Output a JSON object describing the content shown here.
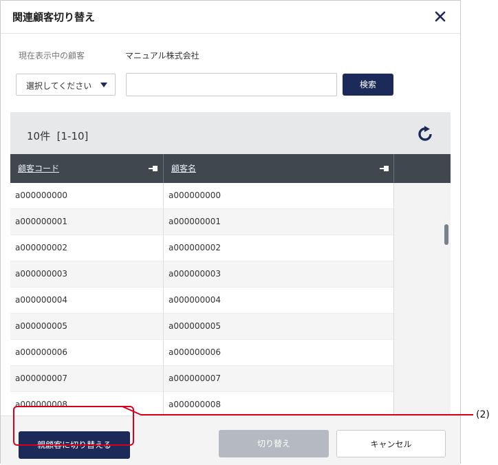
{
  "dialog": {
    "title": "関連顧客切り替え"
  },
  "current_customer": {
    "label": "現在表示中の顧客",
    "value": "マニュアル株式会社"
  },
  "search": {
    "select_value": "選択してください",
    "input_value": "",
    "button_label": "検索"
  },
  "results": {
    "count_text": "10件",
    "range_text": "[1-10]"
  },
  "table": {
    "columns": [
      {
        "label": "顧客コード"
      },
      {
        "label": "顧客名"
      }
    ],
    "rows": [
      {
        "code": "a000000000",
        "name": "a000000000"
      },
      {
        "code": "a000000001",
        "name": "a000000001"
      },
      {
        "code": "a000000002",
        "name": "a000000002"
      },
      {
        "code": "a000000003",
        "name": "a000000003"
      },
      {
        "code": "a000000004",
        "name": "a000000004"
      },
      {
        "code": "a000000005",
        "name": "a000000005"
      },
      {
        "code": "a000000006",
        "name": "a000000006"
      },
      {
        "code": "a000000007",
        "name": "a000000007"
      },
      {
        "code": "a000000008",
        "name": "a000000008"
      }
    ]
  },
  "footer": {
    "switch_parent_label": "親顧客に切り替える",
    "switch_label": "切り替え",
    "cancel_label": "キャンセル"
  },
  "annotation": {
    "callout_label": "(2)"
  },
  "colors": {
    "primary": "#1c2a5a",
    "header_dark": "#41474e",
    "disabled": "#b5bac2",
    "highlight": "#d6001c"
  }
}
